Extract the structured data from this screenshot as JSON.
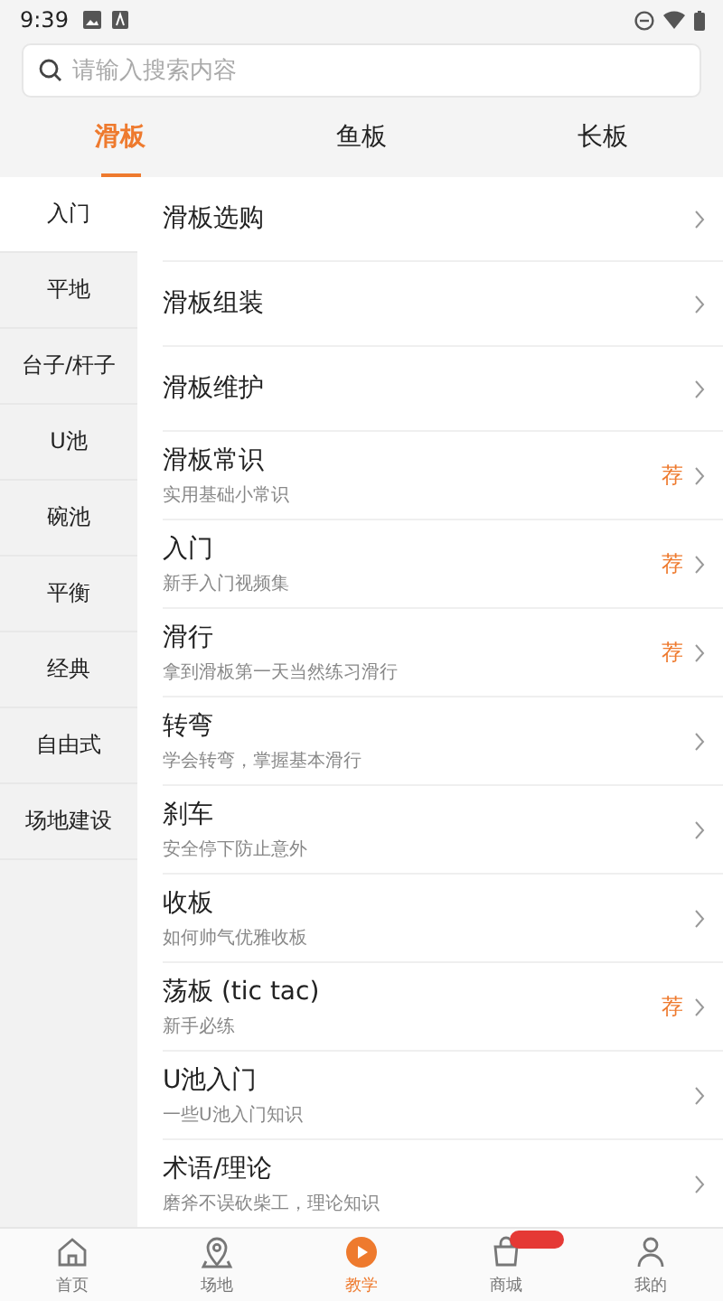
{
  "status_bar": {
    "time": "9:39"
  },
  "search": {
    "placeholder": "请输入搜索内容"
  },
  "tabs": [
    {
      "label": "滑板",
      "selected": true
    },
    {
      "label": "鱼板",
      "selected": false
    },
    {
      "label": "长板",
      "selected": false
    }
  ],
  "sidebar": {
    "items": [
      {
        "label": "入门",
        "selected": true
      },
      {
        "label": "平地",
        "selected": false
      },
      {
        "label": "台子/杆子",
        "selected": false
      },
      {
        "label": "U池",
        "selected": false
      },
      {
        "label": "碗池",
        "selected": false
      },
      {
        "label": "平衡",
        "selected": false
      },
      {
        "label": "经典",
        "selected": false
      },
      {
        "label": "自由式",
        "selected": false
      },
      {
        "label": "场地建设",
        "selected": false
      }
    ]
  },
  "lessons": [
    {
      "title": "滑板选购"
    },
    {
      "title": "滑板组装"
    },
    {
      "title": "滑板维护"
    },
    {
      "title": "滑板常识",
      "subtitle": "实用基础小常识",
      "tag": "荐"
    },
    {
      "title": "入门",
      "subtitle": "新手入门视频集",
      "tag": "荐"
    },
    {
      "title": "滑行",
      "subtitle": "拿到滑板第一天当然练习滑行",
      "tag": "荐"
    },
    {
      "title": "转弯",
      "subtitle": "学会转弯，掌握基本滑行"
    },
    {
      "title": "刹车",
      "subtitle": "安全停下防止意外"
    },
    {
      "title": "收板",
      "subtitle": "如何帅气优雅收板"
    },
    {
      "title": "荡板 (tic tac)",
      "subtitle": "新手必练",
      "tag": "荐"
    },
    {
      "title": "U池入门",
      "subtitle": "一些U池入门知识"
    },
    {
      "title": "术语/理论",
      "subtitle": "磨斧不误砍柴工，理论知识"
    }
  ],
  "bottom_nav": [
    {
      "kind": "home",
      "label": "首页",
      "selected": false,
      "badge": false
    },
    {
      "kind": "pin",
      "label": "场地",
      "selected": false,
      "badge": false
    },
    {
      "kind": "play",
      "label": "教学",
      "selected": true,
      "badge": false
    },
    {
      "kind": "shop",
      "label": "商城",
      "selected": false,
      "badge": true
    },
    {
      "kind": "person",
      "label": "我的",
      "selected": false,
      "badge": false
    }
  ]
}
